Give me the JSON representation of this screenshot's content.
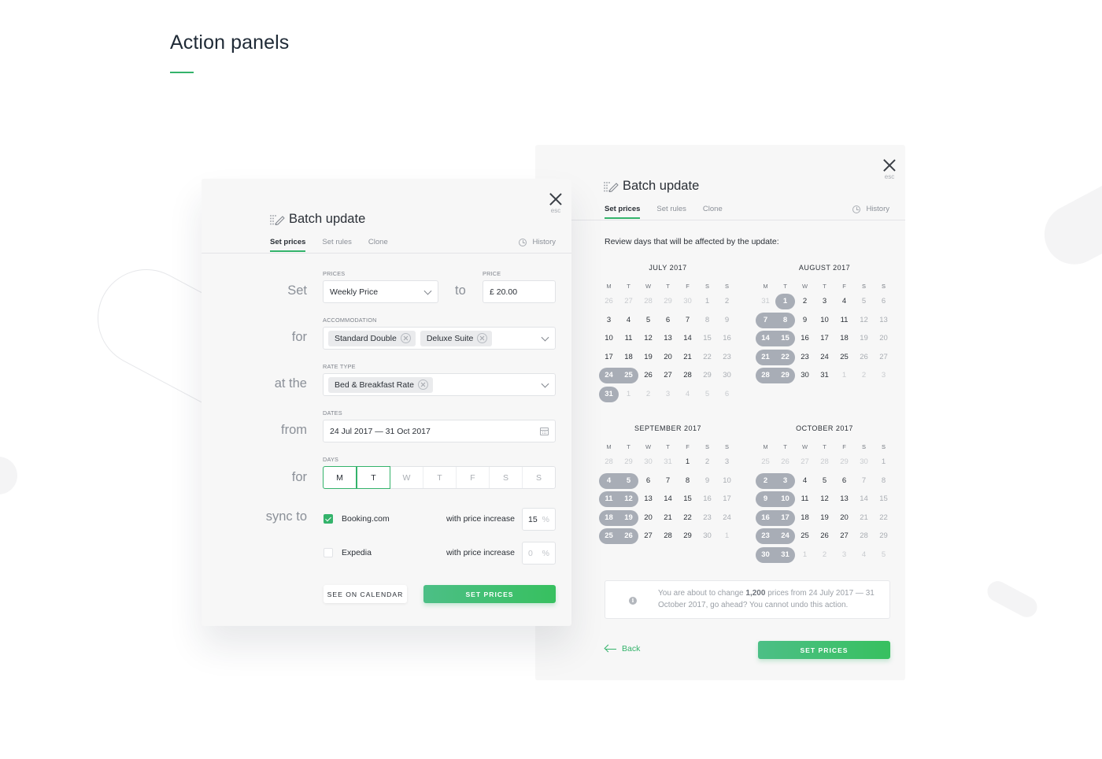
{
  "page": {
    "title": "Action panels",
    "accent": "#34b36b"
  },
  "left_panel": {
    "title": "Batch update",
    "close_hint": "esc",
    "tabs": [
      {
        "label": "Set prices",
        "active": true
      },
      {
        "label": "Set rules",
        "active": false
      },
      {
        "label": "Clone",
        "active": false
      }
    ],
    "history_label": "History",
    "rows": {
      "set": "Set",
      "to": "to",
      "for": "for",
      "at_the": "at the",
      "from": "from",
      "for2": "for",
      "sync_to": "sync to"
    },
    "prices": {
      "label": "PRICES",
      "value": "Weekly Price"
    },
    "price": {
      "label": "PRICE",
      "value": "£ 20.00"
    },
    "accommodation": {
      "label": "ACCOMMODATION",
      "chips": [
        "Standard Double",
        "Deluxe Suite"
      ]
    },
    "rate_type": {
      "label": "RATE TYPE",
      "chips": [
        "Bed & Breakfast Rate"
      ]
    },
    "dates": {
      "label": "DATES",
      "value": "24 Jul 2017 — 31 Oct 2017"
    },
    "days": {
      "label": "DAYS",
      "items": [
        {
          "label": "M",
          "selected": true
        },
        {
          "label": "T",
          "selected": true
        },
        {
          "label": "W",
          "selected": false
        },
        {
          "label": "T",
          "selected": false
        },
        {
          "label": "F",
          "selected": false
        },
        {
          "label": "S",
          "selected": false
        },
        {
          "label": "S",
          "selected": false
        }
      ]
    },
    "sync": [
      {
        "name": "Booking.com",
        "checked": true,
        "increase_label": "with price increase",
        "value": "15",
        "unit": "%"
      },
      {
        "name": "Expedia",
        "checked": false,
        "increase_label": "with price increase",
        "value": "0",
        "unit": "%"
      }
    ],
    "see_calendar_label": "SEE ON CALENDAR",
    "set_prices_label": "SET PRICES"
  },
  "right_panel": {
    "title": "Batch update",
    "close_hint": "esc",
    "tabs": [
      {
        "label": "Set prices",
        "active": true
      },
      {
        "label": "Set rules",
        "active": false
      },
      {
        "label": "Clone",
        "active": false
      }
    ],
    "history_label": "History",
    "review_text": "Review days that will be affected by the update:",
    "weekdays": [
      "M",
      "T",
      "W",
      "T",
      "F",
      "S",
      "S"
    ],
    "months": [
      {
        "title": "JULY 2017",
        "days": [
          "26",
          "27",
          "28",
          "29",
          "30",
          "1",
          "2",
          "3",
          "4",
          "5",
          "6",
          "7",
          "8",
          "9",
          "10",
          "11",
          "12",
          "13",
          "14",
          "15",
          "16",
          "17",
          "18",
          "19",
          "20",
          "21",
          "22",
          "23",
          "24",
          "25",
          "26",
          "27",
          "28",
          "29",
          "30",
          "31",
          "1",
          "2",
          "3",
          "4",
          "5",
          "6"
        ],
        "first_in_month": 5,
        "last_in_month": 35,
        "selected": [
          28,
          29,
          35
        ]
      },
      {
        "title": "AUGUST 2017",
        "days": [
          "31",
          "1",
          "2",
          "3",
          "4",
          "5",
          "6",
          "7",
          "8",
          "9",
          "10",
          "11",
          "12",
          "13",
          "14",
          "15",
          "16",
          "17",
          "18",
          "19",
          "20",
          "21",
          "22",
          "23",
          "24",
          "25",
          "26",
          "27",
          "28",
          "29",
          "30",
          "31",
          "1",
          "2",
          "3"
        ],
        "first_in_month": 1,
        "last_in_month": 31,
        "selected": [
          1,
          7,
          8,
          14,
          15,
          21,
          22,
          28,
          29
        ]
      },
      {
        "title": "SEPTEMBER 2017",
        "days": [
          "28",
          "29",
          "30",
          "31",
          "1",
          "2",
          "3",
          "4",
          "5",
          "6",
          "7",
          "8",
          "9",
          "10",
          "11",
          "12",
          "13",
          "14",
          "15",
          "16",
          "17",
          "18",
          "19",
          "20",
          "21",
          "22",
          "23",
          "24",
          "25",
          "26",
          "27",
          "28",
          "29",
          "30",
          "1"
        ],
        "first_in_month": 4,
        "last_in_month": 33,
        "selected": [
          7,
          8,
          14,
          15,
          21,
          22,
          28,
          29
        ]
      },
      {
        "title": "OCTOBER 2017",
        "days": [
          "25",
          "26",
          "27",
          "28",
          "29",
          "30",
          "1",
          "2",
          "3",
          "4",
          "5",
          "6",
          "7",
          "8",
          "9",
          "10",
          "11",
          "12",
          "13",
          "14",
          "15",
          "16",
          "17",
          "18",
          "19",
          "20",
          "21",
          "22",
          "23",
          "24",
          "25",
          "26",
          "27",
          "28",
          "29",
          "30",
          "31",
          "1",
          "2",
          "3",
          "4",
          "5"
        ],
        "first_in_month": 6,
        "last_in_month": 36,
        "selected": [
          7,
          8,
          14,
          15,
          21,
          22,
          28,
          29,
          35,
          36
        ]
      }
    ],
    "notice": {
      "pre": "You are about to change ",
      "count": "1,200",
      "post": " prices from 24 July 2017 — 31 October 2017, go ahead? You cannot undo this action."
    },
    "back_label": "Back",
    "set_prices_label": "SET PRICES"
  }
}
